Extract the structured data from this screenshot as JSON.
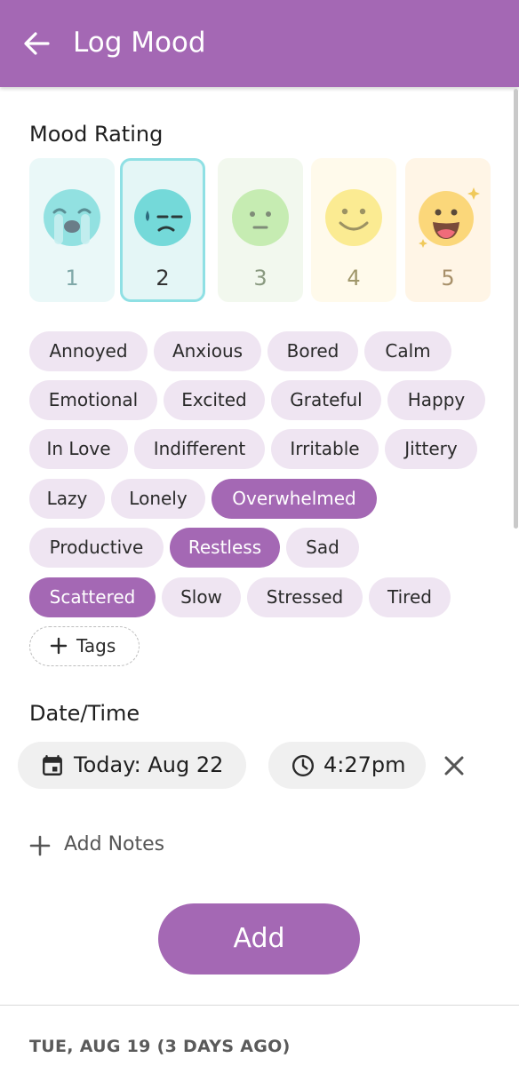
{
  "header": {
    "title": "Log Mood",
    "back_icon": "arrow-left-icon"
  },
  "mood_rating": {
    "label": "Mood Rating",
    "selected": "2",
    "options": [
      {
        "value": "1",
        "face": "crying-face-icon",
        "bg": "#eaf8f8",
        "num_color": "#7fa8a8"
      },
      {
        "value": "2",
        "face": "sad-sweat-face-icon",
        "bg": "#e4f6f6",
        "num_color": "#333333"
      },
      {
        "value": "3",
        "face": "neutral-face-icon",
        "bg": "#f2f8ee",
        "num_color": "#8a9a80"
      },
      {
        "value": "4",
        "face": "smiling-face-icon",
        "bg": "#fffaeb",
        "num_color": "#a0976a"
      },
      {
        "value": "5",
        "face": "grinning-sparkle-face-icon",
        "bg": "#fff5e6",
        "num_color": "#a8906a"
      }
    ]
  },
  "tags": {
    "items": [
      {
        "label": "Annoyed",
        "selected": false
      },
      {
        "label": "Anxious",
        "selected": false
      },
      {
        "label": "Bored",
        "selected": false
      },
      {
        "label": "Calm",
        "selected": false
      },
      {
        "label": "Emotional",
        "selected": false
      },
      {
        "label": "Excited",
        "selected": false
      },
      {
        "label": "Grateful",
        "selected": false
      },
      {
        "label": "Happy",
        "selected": false
      },
      {
        "label": "In Love",
        "selected": false
      },
      {
        "label": "Indifferent",
        "selected": false
      },
      {
        "label": "Irritable",
        "selected": false
      },
      {
        "label": "Jittery",
        "selected": false
      },
      {
        "label": "Lazy",
        "selected": false
      },
      {
        "label": "Lonely",
        "selected": false
      },
      {
        "label": "Overwhelmed",
        "selected": true
      },
      {
        "label": "Productive",
        "selected": false
      },
      {
        "label": "Restless",
        "selected": true
      },
      {
        "label": "Sad",
        "selected": false
      },
      {
        "label": "Scattered",
        "selected": true
      },
      {
        "label": "Slow",
        "selected": false
      },
      {
        "label": "Stressed",
        "selected": false
      },
      {
        "label": "Tired",
        "selected": false
      }
    ],
    "add_label": "Tags",
    "add_icon": "plus-icon"
  },
  "datetime": {
    "label": "Date/Time",
    "date_value": "Today: Aug 22",
    "date_icon": "calendar-icon",
    "time_value": "4:27pm",
    "time_icon": "clock-icon",
    "clear_icon": "close-icon"
  },
  "notes": {
    "add_label": "Add Notes",
    "icon": "plus-icon"
  },
  "actions": {
    "add_label": "Add"
  },
  "history": {
    "day_label": "TUE, AUG 19 (3 DAYS AGO)"
  },
  "colors": {
    "primary": "#a468b4",
    "chip_bg": "#efe5f2",
    "selected_border": "#8fe0e4"
  }
}
